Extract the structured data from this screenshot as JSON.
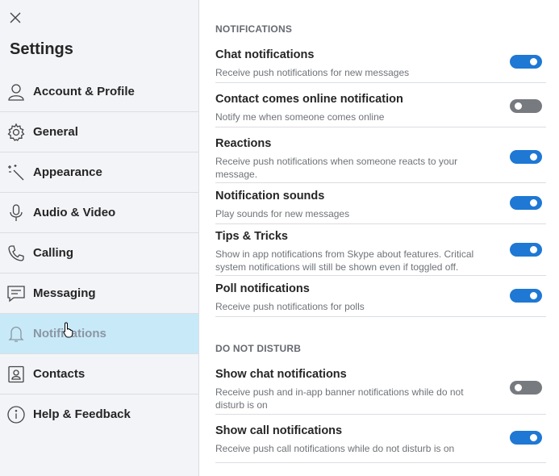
{
  "sidebar": {
    "title": "Settings",
    "items": [
      {
        "label": "Account & Profile",
        "icon": "person-icon"
      },
      {
        "label": "General",
        "icon": "gear-icon"
      },
      {
        "label": "Appearance",
        "icon": "magic-wand-icon"
      },
      {
        "label": "Audio & Video",
        "icon": "microphone-icon"
      },
      {
        "label": "Calling",
        "icon": "phone-icon"
      },
      {
        "label": "Messaging",
        "icon": "message-icon"
      },
      {
        "label": "Notifications",
        "icon": "bell-icon",
        "active": true
      },
      {
        "label": "Contacts",
        "icon": "contact-card-icon"
      },
      {
        "label": "Help & Feedback",
        "icon": "info-icon"
      }
    ]
  },
  "main": {
    "notifications_section": {
      "title": "NOTIFICATIONS",
      "settings": [
        {
          "title": "Chat notifications",
          "description": "Receive push notifications for new messages",
          "enabled": true
        },
        {
          "title": "Contact comes online notification",
          "description": "Notify me when someone comes online",
          "enabled": false
        },
        {
          "title": "Reactions",
          "description": "Receive push notifications when someone reacts to your message.",
          "enabled": true
        },
        {
          "title": "Notification sounds",
          "description": "Play sounds for new messages",
          "enabled": true
        },
        {
          "title": "Tips & Tricks",
          "description": "Show in app notifications from Skype about features. Critical system notifications will still be shown even if toggled off.",
          "enabled": true
        },
        {
          "title": "Poll notifications",
          "description": "Receive push notifications for polls",
          "enabled": true
        }
      ]
    },
    "dnd_section": {
      "title": "DO NOT DISTURB",
      "settings": [
        {
          "title": "Show chat notifications",
          "description": "Receive push and in-app banner notifications while do not disturb is on",
          "enabled": false
        },
        {
          "title": "Show call notifications",
          "description": "Receive push call notifications while do not disturb is on",
          "enabled": true
        }
      ]
    }
  },
  "colors": {
    "accent": "#1e78d4",
    "toggle_off": "#777b80",
    "active_item": "#c8e9f8",
    "sidebar_bg": "#f3f4f8"
  }
}
